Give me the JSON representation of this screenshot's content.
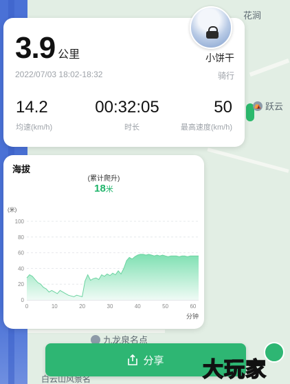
{
  "map": {
    "place_top": "花涧",
    "place_right": "跃云",
    "place_bottom": "九龙泉名点",
    "place_bottom2": "白云山风景名"
  },
  "summary": {
    "distance_value": "3.9",
    "distance_unit": "公里",
    "time_range": "2022/07/03 18:02-18:32",
    "username": "小饼干",
    "activity": "骑行",
    "stats": [
      {
        "value": "14.2",
        "label": "均速(km/h)"
      },
      {
        "value": "00:32:05",
        "label": "时长"
      },
      {
        "value": "50",
        "label": "最高速度(km/h)"
      }
    ]
  },
  "elevation": {
    "title": "海拔",
    "climb_label": "(累计爬升)",
    "climb_value": "18",
    "climb_unit": "米",
    "accent": "#1fb46a"
  },
  "chart_data": {
    "type": "area",
    "ylabel": "(米)",
    "xlabel": "分钟",
    "ylim": [
      0,
      100
    ],
    "xlim": [
      0,
      62
    ],
    "yticks": [
      0,
      20,
      40,
      60,
      80,
      100
    ],
    "xticks": [
      0,
      10,
      20,
      30,
      40,
      50,
      60
    ],
    "x": [
      0,
      1,
      2,
      3,
      4,
      5,
      6,
      7,
      8,
      9,
      10,
      11,
      12,
      13,
      14,
      15,
      16,
      17,
      18,
      19,
      20,
      21,
      22,
      23,
      24,
      25,
      26,
      27,
      28,
      29,
      30,
      31,
      32,
      33,
      34,
      35,
      36,
      37,
      38,
      39,
      40,
      41,
      42,
      43,
      44,
      45,
      46,
      47,
      48,
      49,
      50,
      51,
      52,
      53,
      54,
      55,
      56,
      57,
      58,
      59,
      60,
      61,
      62
    ],
    "values": [
      28,
      32,
      30,
      26,
      22,
      20,
      16,
      14,
      10,
      12,
      10,
      8,
      12,
      10,
      8,
      6,
      5,
      4,
      6,
      5,
      4,
      24,
      32,
      25,
      27,
      28,
      26,
      32,
      30,
      33,
      31,
      34,
      32,
      37,
      33,
      40,
      50,
      54,
      52,
      55,
      57,
      58,
      58,
      57,
      58,
      57,
      56,
      57,
      56,
      57,
      56,
      55,
      56,
      56,
      56,
      55,
      56,
      56,
      55,
      56,
      56,
      56,
      56
    ]
  },
  "actions": {
    "share_label": "分享"
  },
  "watermark": "大玩家"
}
